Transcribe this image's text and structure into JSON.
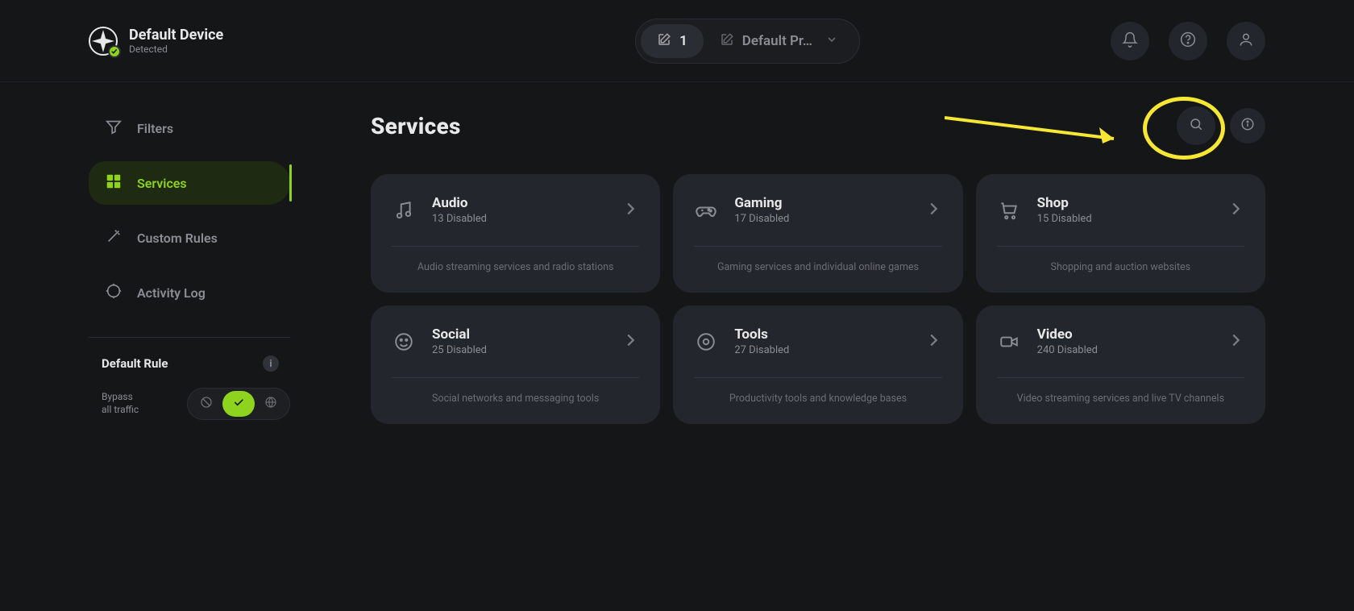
{
  "header": {
    "device_name": "Default Device",
    "device_status": "Detected",
    "profile": {
      "badge_count": "1",
      "name": "Default Pr…"
    }
  },
  "sidebar": {
    "items": [
      {
        "label": "Filters"
      },
      {
        "label": "Services"
      },
      {
        "label": "Custom Rules"
      },
      {
        "label": "Activity Log"
      }
    ],
    "default_rule_title": "Default Rule",
    "bypass_label_1": "Bypass",
    "bypass_label_2": "all traffic"
  },
  "page": {
    "title": "Services"
  },
  "cards": [
    {
      "title": "Audio",
      "subtitle": "13 Disabled",
      "desc": "Audio streaming services and radio stations"
    },
    {
      "title": "Gaming",
      "subtitle": "17 Disabled",
      "desc": "Gaming services and individual online games"
    },
    {
      "title": "Shop",
      "subtitle": "15 Disabled",
      "desc": "Shopping and auction websites"
    },
    {
      "title": "Social",
      "subtitle": "25 Disabled",
      "desc": "Social networks and messaging tools"
    },
    {
      "title": "Tools",
      "subtitle": "27 Disabled",
      "desc": "Productivity tools and knowledge bases"
    },
    {
      "title": "Video",
      "subtitle": "240 Disabled",
      "desc": "Video streaming services and live TV channels"
    }
  ]
}
